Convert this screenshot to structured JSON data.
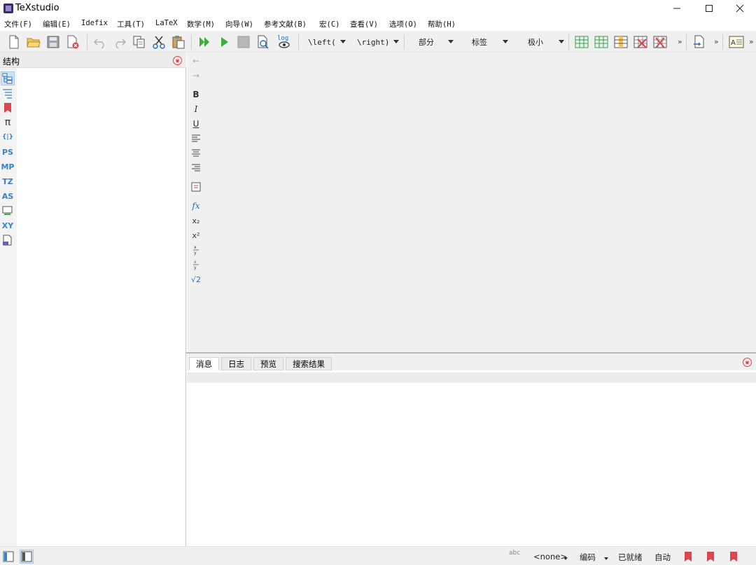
{
  "window": {
    "title": "TeXstudio",
    "minimize_glyph": "—",
    "maximize_glyph": "☐",
    "close_glyph": "✕"
  },
  "menu": [
    {
      "label": "文件(F)"
    },
    {
      "label": "编辑(E)"
    },
    {
      "label": "Idefix"
    },
    {
      "label": "工具(T)"
    },
    {
      "label": "LaTeX"
    },
    {
      "label": "数学(M)"
    },
    {
      "label": "向导(W)"
    },
    {
      "label": "参考文献(B)"
    },
    {
      "label": "宏(C)"
    },
    {
      "label": "查看(V)"
    },
    {
      "label": "选项(O)"
    },
    {
      "label": "帮助(H)"
    }
  ],
  "toolbar": {
    "left_bracket": "\\left(",
    "right_bracket": "\\right)",
    "sectioning": "部分",
    "label": "标签",
    "size": "极小",
    "log_label": "log",
    "more": "»"
  },
  "structure": {
    "title": "结构",
    "side_items": [
      {
        "label": ""
      },
      {
        "label": ""
      },
      {
        "label": ""
      },
      {
        "label": "π"
      },
      {
        "label": "{|}"
      },
      {
        "label": "PS"
      },
      {
        "label": "MP"
      },
      {
        "label": "TZ"
      },
      {
        "label": "AS"
      },
      {
        "label": ""
      },
      {
        "label": "XY"
      },
      {
        "label": ""
      }
    ]
  },
  "format": {
    "back": "←",
    "forward": "→",
    "bold": "B",
    "italic": "I",
    "underline": "U",
    "subscript": "x₂",
    "superscript": "x²",
    "sqrt": "√2",
    "fx": "fx"
  },
  "messages": {
    "tabs": [
      "消息",
      "日志",
      "预览",
      "搜索结果"
    ],
    "active_tab": "消息"
  },
  "status": {
    "spell": "abc",
    "language": "<none>",
    "encoding": "编码",
    "ready": "已就绪",
    "auto": "自动"
  },
  "colors": {
    "accent_blue": "#3a82c8",
    "run_green": "#3cae3a",
    "close_red": "#d6454a",
    "table_green": "#3a9a4a"
  }
}
